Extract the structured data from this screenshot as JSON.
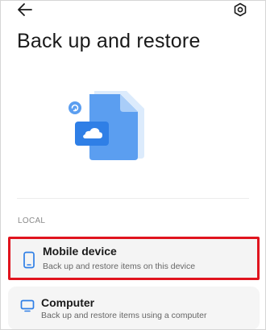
{
  "header": {
    "back_icon": "arrow-left-icon",
    "settings_icon": "gear-icon",
    "title": "Back up and restore"
  },
  "illustration": {
    "name": "backup-file-illustration",
    "accent": "#5b9ef0",
    "light": "#cfe3fb"
  },
  "section": {
    "label": "LOCAL"
  },
  "options": [
    {
      "icon": "phone-icon",
      "title": "Mobile device",
      "subtitle": "Back up and restore items on this device",
      "highlighted": true
    },
    {
      "icon": "monitor-icon",
      "title": "Computer",
      "subtitle": "Back up and restore items using a computer",
      "highlighted": false
    }
  ],
  "colors": {
    "accent_blue": "#2f7fe6",
    "highlight_red": "#e0141e"
  }
}
